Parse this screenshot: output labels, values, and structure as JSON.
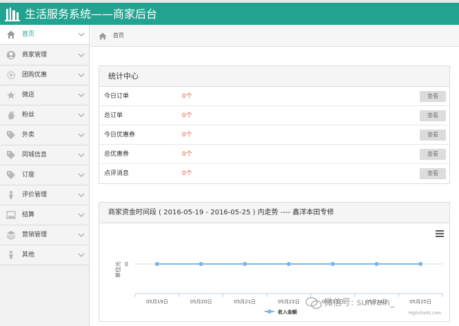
{
  "app": {
    "title": "生活服务系统——商家后台"
  },
  "sidebar": {
    "items": [
      {
        "label": "首页",
        "icon": "home-icon",
        "active": true
      },
      {
        "label": "商家管理",
        "icon": "user-icon"
      },
      {
        "label": "团购优惠",
        "icon": "gear-icon"
      },
      {
        "label": "微店",
        "icon": "star-icon"
      },
      {
        "label": "粉丝",
        "icon": "hand-icon"
      },
      {
        "label": "外卖",
        "icon": "tag-icon"
      },
      {
        "label": "同城信息",
        "icon": "tag-icon"
      },
      {
        "label": "订座",
        "icon": "tag-icon"
      },
      {
        "label": "评价管理",
        "icon": "person-icon"
      },
      {
        "label": "结算",
        "icon": "image-icon"
      },
      {
        "label": "营销管理",
        "icon": "stack-icon"
      },
      {
        "label": "其他",
        "icon": "person-icon"
      }
    ]
  },
  "breadcrumb": {
    "current": "首页"
  },
  "stats": {
    "title": "统计中心",
    "button_label": "查看",
    "rows": [
      {
        "label": "今日订单",
        "value": "0个"
      },
      {
        "label": "总订单",
        "value": "0个"
      },
      {
        "label": "今日优惠券",
        "value": "0个"
      },
      {
        "label": "总优惠券",
        "value": "0个"
      },
      {
        "label": "点评消息",
        "value": "0个"
      }
    ]
  },
  "trend": {
    "title": "商家资金时间段 ( 2016-05-19 - 2016-05-25 ) 内走势 ---- 鑫洋本田专修",
    "credits": "Highcharts.com"
  },
  "chart_data": {
    "type": "line",
    "categories": [
      "05月19日",
      "05月20日",
      "05月21日",
      "05月22日",
      "05月23日",
      "05月24日",
      "05月25日"
    ],
    "series": [
      {
        "name": "收入金额",
        "values": [
          0,
          0,
          0,
          0,
          0,
          0,
          0
        ],
        "color": "#7cb5ec"
      }
    ],
    "ylabel": "单位元",
    "yticks": [
      0
    ],
    "legend": "bottom-center",
    "grid": true
  },
  "watermark": {
    "text": "微信号: sunrain_"
  },
  "colors": {
    "header": "#22a390",
    "accent": "#22a390",
    "value": "#e4573b",
    "series": "#7cb5ec"
  }
}
